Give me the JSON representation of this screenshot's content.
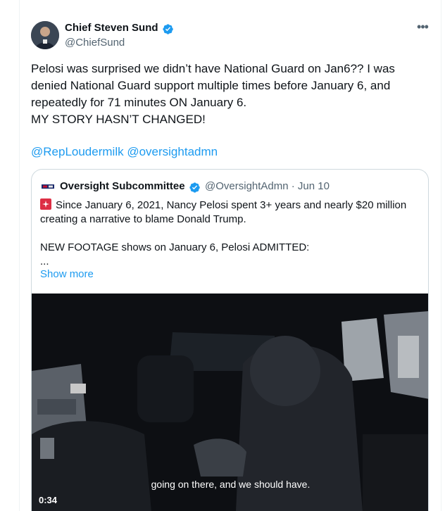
{
  "author": {
    "name": "Chief Steven Sund",
    "handle": "@ChiefSund",
    "verified": true
  },
  "tweet": {
    "lines": [
      "Pelosi was surprised we didn’t have National Guard on Jan6?? I was",
      "denied National Guard support multiple times before January 6, and",
      "repeatedly for 71 minutes ON January 6.",
      "MY STORY HASN’T CHANGED!"
    ],
    "mentions": [
      "@RepLoudermilk",
      "@oversightadmn"
    ]
  },
  "quote": {
    "name": "Oversight Subcommittee",
    "handle_date": "@OversightAdmn · Jun 10",
    "verified": true,
    "text_lines": [
      "Since January 6, 2021, Nancy Pelosi spent 3+ years and nearly $20 million",
      "creating a narrative to blame Donald Trump.",
      "",
      "NEW FOOTAGE shows on January 6, Pelosi ADMITTED:",
      "..."
    ],
    "show_more": "Show more",
    "video": {
      "subtitle": "going on there, and we should have.",
      "duration": "0:34"
    }
  },
  "colors": {
    "accent": "#1d9bf0",
    "text": "#0f1419",
    "secondary": "#536471",
    "border": "#cfd9de"
  }
}
